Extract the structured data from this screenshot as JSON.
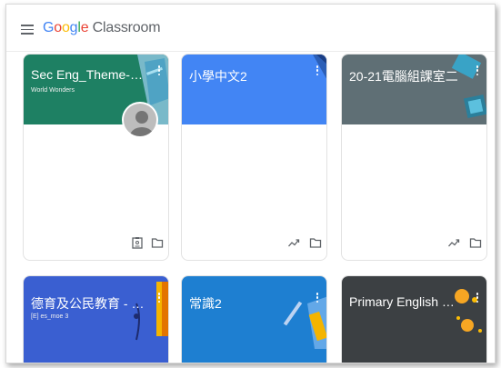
{
  "app": {
    "brand_parts": [
      "G",
      "o",
      "o",
      "g",
      "l",
      "e"
    ],
    "brand_suffix": " Classroom"
  },
  "colors": {
    "teal": "#1e8063",
    "blue": "#4285f4",
    "slate": "#5f6f75",
    "royal": "#3a5fd1",
    "sky": "#1e7fd1",
    "dark": "#3c4043"
  },
  "cards": [
    {
      "title": "Sec Eng_Theme-bas...",
      "subtitle": "World Wonders",
      "footer_icons": [
        "assignment-icon",
        "folder-icon"
      ]
    },
    {
      "title": "小學中文2",
      "subtitle": "",
      "footer_icons": [
        "trend-icon",
        "folder-icon"
      ]
    },
    {
      "title": "20-21電腦組課室二",
      "subtitle": "",
      "footer_icons": [
        "trend-icon",
        "folder-icon"
      ]
    },
    {
      "title": "德育及公民教育 - 教...",
      "subtitle": "[E] es_moe 3",
      "footer_icons": []
    },
    {
      "title": "常識2",
      "subtitle": "",
      "footer_icons": []
    },
    {
      "title": "Primary English Reso...",
      "subtitle": "",
      "footer_icons": []
    }
  ]
}
